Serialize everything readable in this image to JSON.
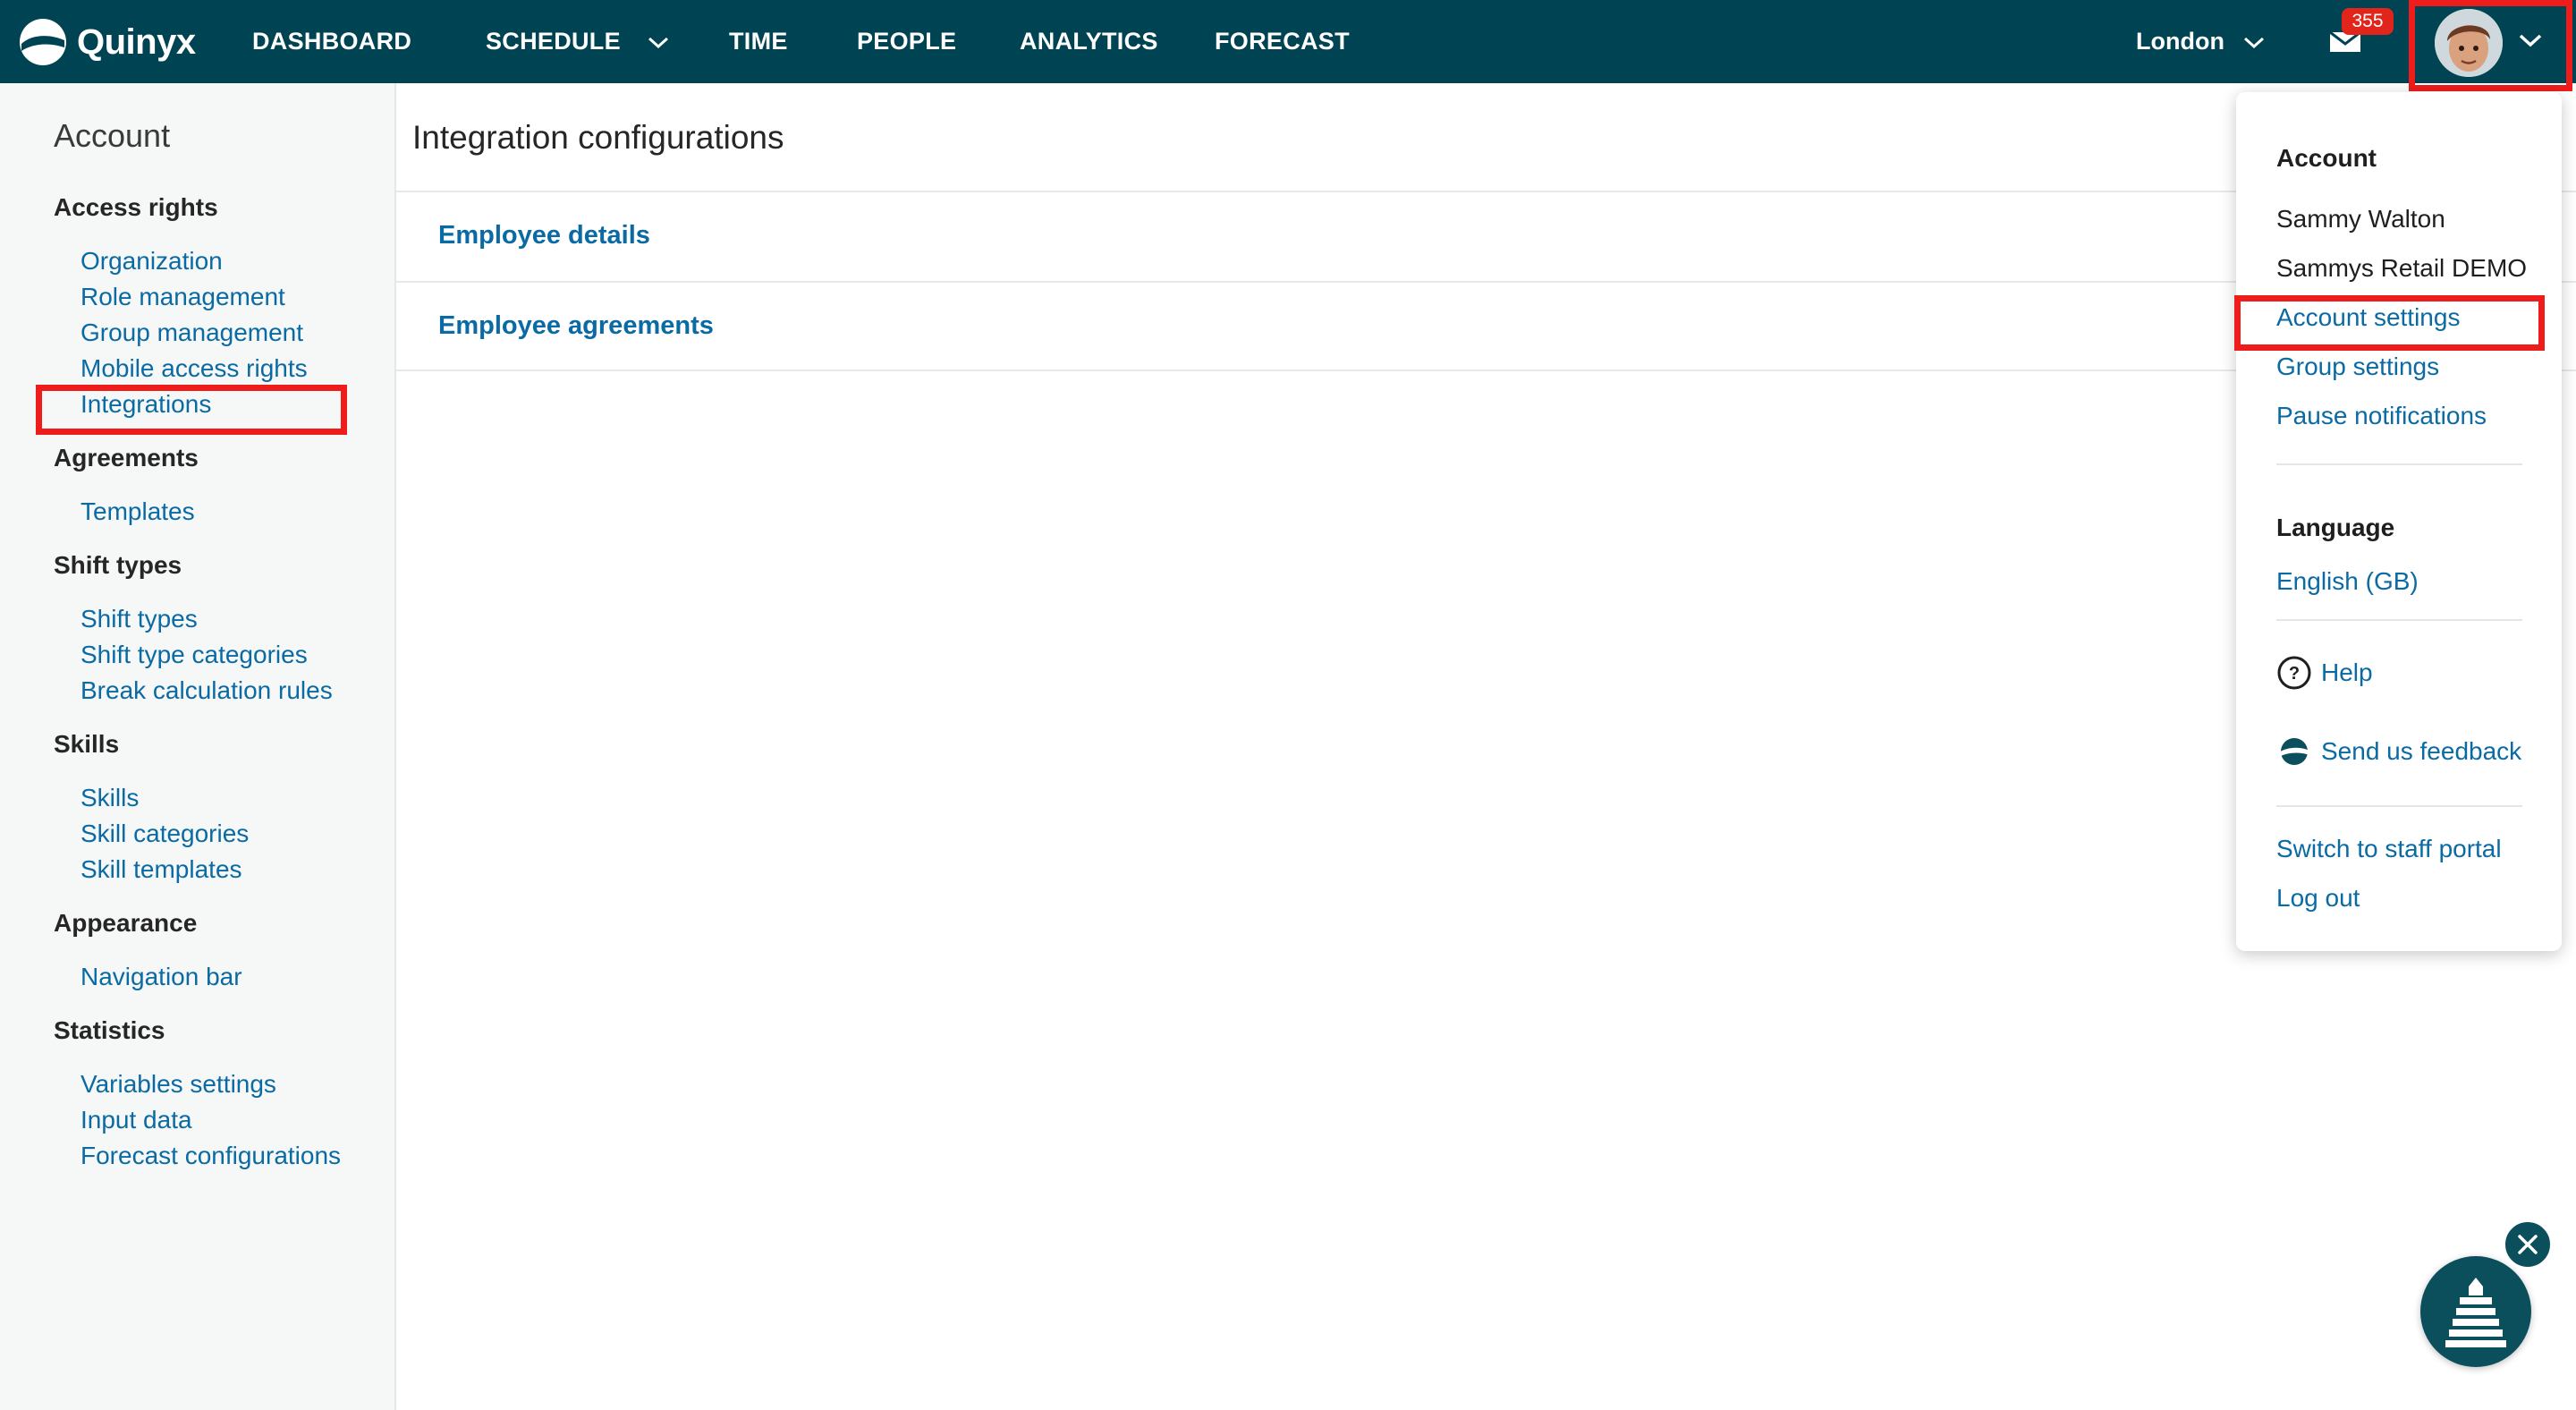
{
  "app": {
    "logo_text": "Quinyx",
    "brand_color": "#004352",
    "accent_color": "#0a6aa3",
    "highlight_color": "#ef1c1c"
  },
  "nav": {
    "items": [
      {
        "label": "DASHBOARD"
      },
      {
        "label": "SCHEDULE",
        "has_dropdown": true
      },
      {
        "label": "TIME"
      },
      {
        "label": "PEOPLE"
      },
      {
        "label": "ANALYTICS"
      },
      {
        "label": "FORECAST"
      }
    ],
    "location": "London",
    "inbox_icon": "mail-icon",
    "inbox_count": "355",
    "avatar_icon": "user-avatar"
  },
  "sidebar": {
    "title": "Account",
    "sections": [
      {
        "heading": "Access rights",
        "links": [
          "Organization",
          "Role management",
          "Group management",
          "Mobile access rights",
          "Integrations"
        ]
      },
      {
        "heading": "Agreements",
        "links": [
          "Templates"
        ]
      },
      {
        "heading": "Shift types",
        "links": [
          "Shift types",
          "Shift type categories",
          "Break calculation rules"
        ]
      },
      {
        "heading": "Skills",
        "links": [
          "Skills",
          "Skill categories",
          "Skill templates"
        ]
      },
      {
        "heading": "Appearance",
        "links": [
          "Navigation bar"
        ]
      },
      {
        "heading": "Statistics",
        "links": [
          "Variables settings",
          "Input data",
          "Forecast configurations"
        ]
      }
    ],
    "highlighted_link": "Integrations"
  },
  "main": {
    "title": "Integration configurations",
    "rows": [
      {
        "label": "Employee details"
      },
      {
        "label": "Employee agreements"
      }
    ]
  },
  "account_menu": {
    "heading": "Account",
    "user_name": "Sammy Walton",
    "company": "Sammys Retail DEMO",
    "links": [
      "Account settings",
      "Group settings",
      "Pause notifications"
    ],
    "highlighted_link": "Account settings",
    "language_heading": "Language",
    "language": "English (GB)",
    "help": "Help",
    "help_icon": "help-circle-icon",
    "feedback": "Send us feedback",
    "feedback_icon": "quinyx-logo-icon",
    "switch_portal": "Switch to staff portal",
    "logout": "Log out"
  },
  "chat_widget": {
    "icon": "lighthouse-icon",
    "close_icon": "close-icon"
  }
}
